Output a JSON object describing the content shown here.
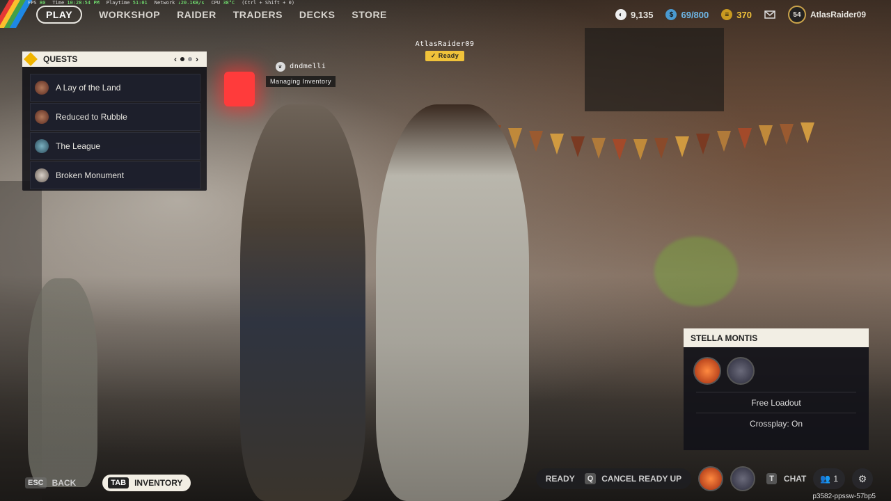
{
  "debug": {
    "fps_label": "FPS",
    "fps": "80",
    "time_label": "Time",
    "time": "10:28:54 PM",
    "playtime_label": "Playtime",
    "playtime": "51:01",
    "network_label": "Network",
    "network": "↓20.1KB/s",
    "cpu_label": "CPU",
    "cpu": "38°C",
    "hint": "(Ctrl + Shift + 0)"
  },
  "nav": {
    "play": "PLAY",
    "workshop": "WORKSHOP",
    "raider": "RAIDER",
    "traders": "TRADERS",
    "decks": "DECKS",
    "store": "STORE"
  },
  "currency": {
    "coins": "9,135",
    "tokens": "69/800",
    "credits": "370",
    "level": "54",
    "username": "AtlasRaider09"
  },
  "quests": {
    "title": "QUESTS",
    "prev": "‹",
    "next": "›",
    "items": [
      {
        "label": "A Lay of the Land",
        "icon": "raider-portrait-icon"
      },
      {
        "label": "Reduced to Rubble",
        "icon": "raider-portrait-icon"
      },
      {
        "label": "The League",
        "icon": "globe-portrait-icon"
      },
      {
        "label": "Broken Monument",
        "icon": "trader-portrait-icon"
      }
    ]
  },
  "players": {
    "self_name": "AtlasRaider09",
    "self_status": "Ready",
    "other_name": "dndmelli",
    "other_status": "Managing Inventory"
  },
  "party": {
    "title": "STELLA MONTIS",
    "loadout": "Free Loadout",
    "crossplay": "Crossplay: On"
  },
  "bottom": {
    "esc_key": "ESC",
    "back": "BACK",
    "tab_key": "TAB",
    "inventory": "INVENTORY",
    "ready": "READY",
    "q_key": "Q",
    "cancel_ready": "CANCEL READY UP",
    "t_key": "T",
    "chat": "CHAT",
    "party_count": "1",
    "session_code": "p3582-ppssw-57bp5"
  },
  "colors": {
    "accent_yellow": "#f0c23a",
    "panel_light": "#f2eee4",
    "panel_dark": "#12121a"
  }
}
